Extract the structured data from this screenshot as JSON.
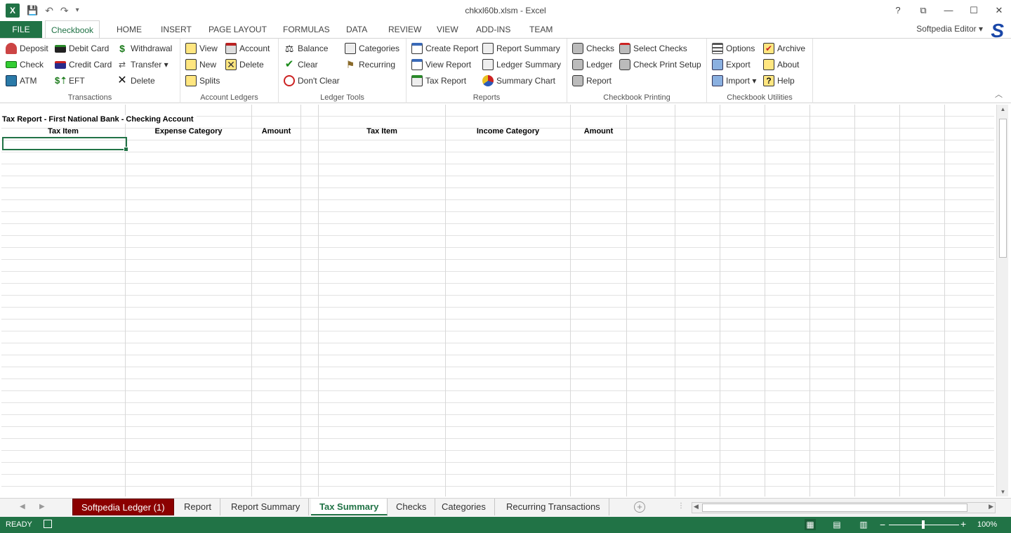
{
  "window": {
    "title": "chkxl60b.xlsm - Excel",
    "controls": [
      "?",
      "⧉",
      "—",
      "☐",
      "✕"
    ]
  },
  "qat": {
    "app_icon": "X",
    "save": "💾",
    "undo": "↶",
    "redo": "↷",
    "more": "▾"
  },
  "tabs": {
    "file": "FILE",
    "items": [
      "Checkbook",
      "HOME",
      "INSERT",
      "PAGE LAYOUT",
      "FORMULAS",
      "DATA",
      "REVIEW",
      "VIEW",
      "ADD-INS",
      "TEAM"
    ],
    "active": "Checkbook"
  },
  "account": {
    "name": "Softpedia Editor ▾",
    "logo": "S"
  },
  "ribbon": {
    "transactions": {
      "label": "Transactions",
      "buttons": [
        "Deposit",
        "Debit Card",
        "Withdrawal",
        "Check",
        "Credit Card",
        "Transfer ▾",
        "ATM",
        "EFT",
        "Delete"
      ]
    },
    "account_ledgers": {
      "label": "Account Ledgers",
      "buttons": [
        "View",
        "Account",
        "New",
        "Delete",
        "Splits"
      ]
    },
    "ledger_tools": {
      "label": "Ledger Tools",
      "buttons": [
        "Balance",
        "Categories",
        "Clear",
        "Recurring",
        "Don't Clear"
      ]
    },
    "reports": {
      "label": "Reports",
      "buttons": [
        "Create Report",
        "Report Summary",
        "View Report",
        "Ledger Summary",
        "Tax Report",
        "Summary Chart"
      ]
    },
    "checkbook_printing": {
      "label": "Checkbook Printing",
      "buttons": [
        "Checks",
        "Select Checks",
        "Ledger",
        "Check Print Setup",
        "Report"
      ]
    },
    "checkbook_utilities": {
      "label": "Checkbook Utilities",
      "buttons": [
        "Options",
        "Archive",
        "Export",
        "About",
        "Import ▾",
        "Help"
      ]
    }
  },
  "sheet": {
    "title": "Tax Report - First National Bank - Checking Account",
    "headers": [
      "Tax Item",
      "Expense Category",
      "Amount",
      "Tax Item",
      "Income Category",
      "Amount"
    ]
  },
  "sheet_tabs": {
    "items": [
      "Softpedia Ledger (1)",
      "Report",
      "Report Summary",
      "Tax Summary",
      "Checks",
      "Categories",
      "Recurring Transactions"
    ],
    "active": "Tax Summary",
    "add": "+"
  },
  "status": {
    "ready": "READY",
    "zoom": "100%",
    "zoom_level_percent": 100
  }
}
